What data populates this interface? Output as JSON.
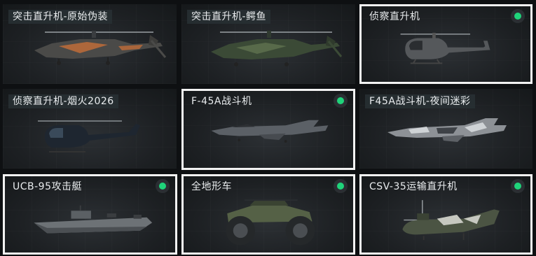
{
  "vehicles": [
    {
      "name": "突击直升机-原始伪装",
      "owned": false,
      "selected": false,
      "icon": "attack-helicopter-camo-icon"
    },
    {
      "name": "突击直升机-鳄鱼",
      "owned": false,
      "selected": false,
      "icon": "attack-helicopter-green-icon"
    },
    {
      "name": "侦察直升机",
      "owned": true,
      "selected": true,
      "icon": "scout-helicopter-icon"
    },
    {
      "name": "侦察直升机-烟火2026",
      "owned": false,
      "selected": false,
      "icon": "scout-helicopter-dark-icon"
    },
    {
      "name": "F-45A战斗机",
      "owned": true,
      "selected": true,
      "icon": "fighter-jet-icon"
    },
    {
      "name": "F45A战斗机-夜间迷彩",
      "owned": false,
      "selected": false,
      "icon": "fighter-jet-camo-icon"
    },
    {
      "name": "UCB-95攻击艇",
      "owned": true,
      "selected": true,
      "icon": "attack-boat-icon"
    },
    {
      "name": "全地形车",
      "owned": true,
      "selected": true,
      "icon": "atv-icon"
    },
    {
      "name": "CSV-35运输直升机",
      "owned": true,
      "selected": true,
      "icon": "tiltrotor-transport-icon"
    }
  ],
  "colors": {
    "owned": "#1fd37a",
    "selected_border": "#f2f2f2"
  }
}
